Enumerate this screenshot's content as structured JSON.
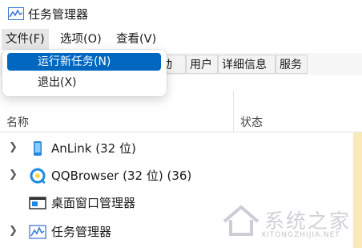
{
  "window": {
    "title": "任务管理器"
  },
  "menubar": {
    "items": [
      {
        "label": "文件(F)"
      },
      {
        "label": "选项(O)"
      },
      {
        "label": "查看(V)"
      }
    ]
  },
  "file_menu": {
    "items": [
      {
        "label": "运行新任务(N)"
      },
      {
        "label": "退出(X)"
      }
    ]
  },
  "tabs": [
    {
      "label": "动"
    },
    {
      "label": "用户"
    },
    {
      "label": "详细信息"
    },
    {
      "label": "服务"
    }
  ],
  "columns": {
    "name": "名称",
    "status": "状态"
  },
  "processes": [
    {
      "name": "AnLink (32 位)",
      "icon": "phone-icon",
      "expandable": true
    },
    {
      "name": "QQBrowser (32 位) (36)",
      "icon": "browser-icon",
      "expandable": true
    },
    {
      "name": "桌面窗口管理器",
      "icon": "window-manager-icon",
      "expandable": false
    },
    {
      "name": "任务管理器",
      "icon": "task-manager-icon",
      "expandable": true
    }
  ],
  "watermark": {
    "text": "系统之家",
    "sub": "XITONGZHIJIA.NET"
  },
  "colors": {
    "accent": "#0067c0",
    "cpu_highlight": "#fbeab9"
  }
}
